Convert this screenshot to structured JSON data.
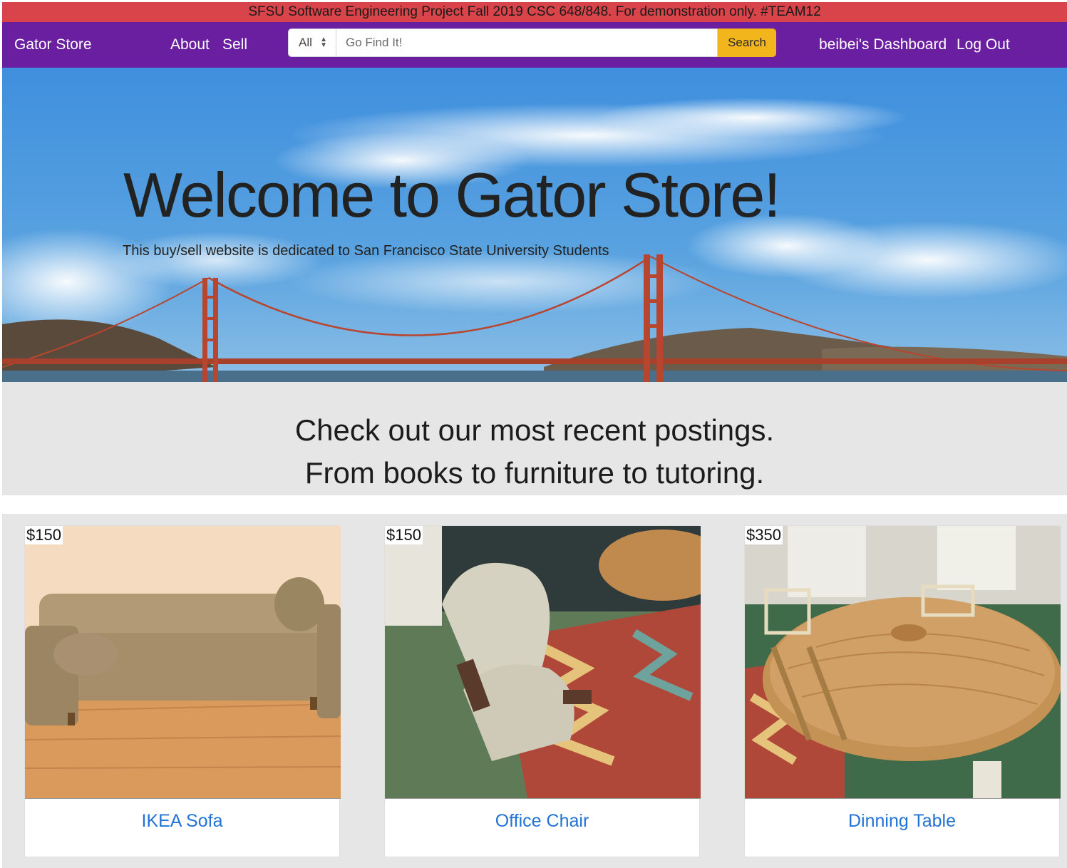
{
  "banner": {
    "text": "SFSU Software Engineering Project Fall 2019 CSC 648/848. For demonstration only. #TEAM12"
  },
  "navbar": {
    "brand": "Gator Store",
    "links": {
      "about": "About",
      "sell": "Sell",
      "dashboard": "beibei's Dashboard",
      "logout": "Log Out"
    },
    "search": {
      "category": "All",
      "placeholder": "Go Find It!",
      "value": "",
      "button": "Search"
    }
  },
  "hero": {
    "title": "Welcome to Gator Store!",
    "subtitle": "This buy/sell website is dedicated to San Francisco State University Students"
  },
  "recent": {
    "line1": "Check out our most recent postings.",
    "line2": "From books to furniture to tutoring."
  },
  "listings": [
    {
      "price": "$150",
      "title": "IKEA Sofa"
    },
    {
      "price": "$150",
      "title": "Office Chair"
    },
    {
      "price": "$350",
      "title": "Dinning Table"
    }
  ],
  "colors": {
    "banner": "#d9434a",
    "navbar": "#6a1fa0",
    "search_button": "#f2b61c",
    "link": "#2174d6",
    "section_bg": "#e7e6e7"
  }
}
